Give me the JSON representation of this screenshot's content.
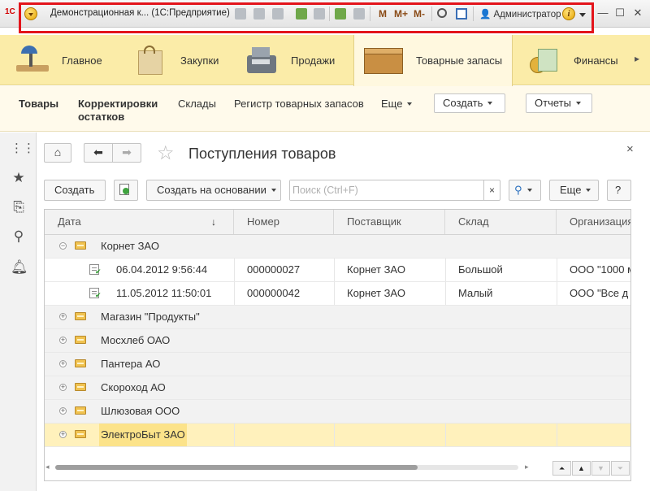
{
  "titlebar": {
    "logo": "1С",
    "title": "Демонстрационная к...  (1С:Предприятие)",
    "m_buttons": [
      "M",
      "M+",
      "M-"
    ],
    "user": "Администратор",
    "info": "i",
    "minimize": "—",
    "maximize": "☐",
    "close": "✕"
  },
  "sections": [
    {
      "label": "Главное"
    },
    {
      "label": "Закупки"
    },
    {
      "label": "Продажи"
    },
    {
      "label": "Товарные запасы"
    },
    {
      "label": "Финансы"
    }
  ],
  "commands": {
    "items": [
      "Товары",
      "Корректировки",
      "остатков",
      "Склады",
      "Регистр товарных запасов"
    ],
    "more": "Еще",
    "create": "Создать",
    "reports": "Отчеты"
  },
  "form": {
    "title": "Поступления товаров",
    "close": "×",
    "create_button": "Создать",
    "create_based_button": "Создать на основании",
    "search_placeholder": "Поиск (Ctrl+F)",
    "search_clear": "×",
    "more_button": "Еще",
    "help_button": "?"
  },
  "table": {
    "columns": [
      "Дата",
      "Номер",
      "Поставщик",
      "Склад",
      "Организация"
    ],
    "sort_indicator": "↓",
    "rows": [
      {
        "kind": "group",
        "expanded": true,
        "name": "Корнет ЗАО"
      },
      {
        "kind": "doc",
        "date": "06.04.2012 9:56:44",
        "number": "000000027",
        "supplier": "Корнет ЗАО",
        "warehouse": "Большой",
        "org": "ООО \"1000 м"
      },
      {
        "kind": "doc",
        "date": "11.05.2012 11:50:01",
        "number": "000000042",
        "supplier": "Корнет ЗАО",
        "warehouse": "Малый",
        "org": "ООО \"Все д"
      },
      {
        "kind": "group",
        "expanded": false,
        "name": "Магазин \"Продукты\""
      },
      {
        "kind": "group",
        "expanded": false,
        "name": "Мосхлеб ОАО"
      },
      {
        "kind": "group",
        "expanded": false,
        "name": "Пантера АО"
      },
      {
        "kind": "group",
        "expanded": false,
        "name": "Скороход АО"
      },
      {
        "kind": "group",
        "expanded": false,
        "name": "Шлюзовая ООО"
      },
      {
        "kind": "group",
        "expanded": false,
        "name": "ЭлектроБыт ЗАО",
        "selected": true
      }
    ]
  },
  "colors": {
    "sections_bg": "#fbeca8",
    "active_section_bg": "#fff8df",
    "highlight_frame": "#e3141b",
    "selected_row": "#fff1bc"
  }
}
